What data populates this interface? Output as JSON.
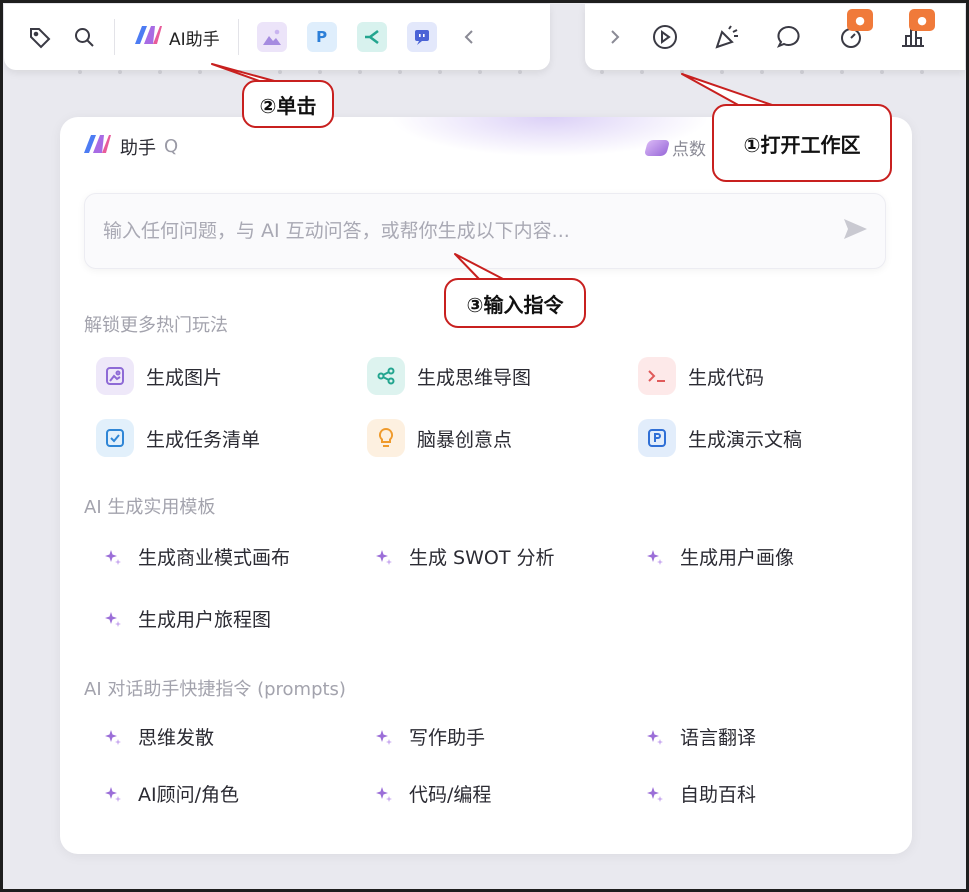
{
  "toolbar_left": {
    "ai_button_label": "AI助手",
    "apps": [
      {
        "icon": "image-app-icon",
        "letter": "",
        "bg": "#ece4f9",
        "fg": "#9a7ad6"
      },
      {
        "icon": "presentation-app-icon",
        "letter": "P",
        "bg": "#dfeefc",
        "fg": "#2c7fd8"
      },
      {
        "icon": "mindmap-app-icon",
        "letter": "",
        "bg": "#d8f2ee",
        "fg": "#23a58f"
      },
      {
        "icon": "whiteboard-app-icon",
        "letter": "",
        "bg": "#e3e8fb",
        "fg": "#4b63d6"
      }
    ]
  },
  "panel": {
    "title": "助手",
    "title_suffix": "Q",
    "points_label": "点数",
    "input_placeholder": "输入任何问题，与 AI 互动问答，或帮你生成以下内容...",
    "sections": {
      "unlock": {
        "title": "解锁更多热门玩法",
        "items": [
          "生成图片",
          "生成思维导图",
          "生成代码",
          "生成任务清单",
          "脑暴创意点",
          "生成演示文稿"
        ]
      },
      "templates": {
        "title": "AI 生成实用模板",
        "items": [
          "生成商业模式画布",
          "生成 SWOT 分析",
          "生成用户画像",
          "生成用户旅程图"
        ]
      },
      "prompts": {
        "title": "AI 对话助手快捷指令 (prompts)",
        "items": [
          "思维发散",
          "写作助手",
          "语言翻译",
          "AI顾问/角色",
          "代码/编程",
          "自助百科"
        ]
      }
    }
  },
  "callouts": {
    "c1": "①打开工作区",
    "c2": "②单击",
    "c3": "③输入指令"
  },
  "colors": {
    "callout_border": "#c8201f",
    "badge": "#f07a3a",
    "spark": "#9b6ed8"
  }
}
